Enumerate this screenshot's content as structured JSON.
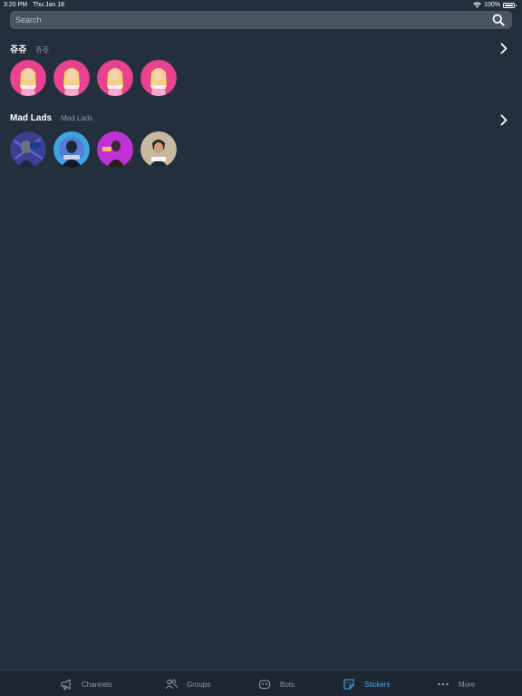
{
  "status_bar": {
    "time": "3:20 PM",
    "date": "Thu Jan 18",
    "battery": "100%",
    "battery_level": 1.0
  },
  "search": {
    "placeholder": "Search"
  },
  "packs": [
    {
      "title": "쥬쥬",
      "subtitle": "쥬쥬",
      "sticker_count": 4
    },
    {
      "title": "Mad Lads",
      "subtitle": "Mad Lads",
      "sticker_count": 4
    }
  ],
  "tabs": [
    {
      "label": "Channels",
      "icon": "megaphone-icon",
      "active": false
    },
    {
      "label": "Groups",
      "icon": "people-icon",
      "active": false
    },
    {
      "label": "Bots",
      "icon": "bot-icon",
      "active": false
    },
    {
      "label": "Stickers",
      "icon": "sticker-icon",
      "active": true
    },
    {
      "label": "More",
      "icon": "ellipsis-icon",
      "active": false
    }
  ],
  "colors": {
    "background": "#232f3d",
    "tab_active": "#4ea8e6",
    "tab_inactive": "#8e99a5",
    "pink_sticker": "#e9428f"
  }
}
